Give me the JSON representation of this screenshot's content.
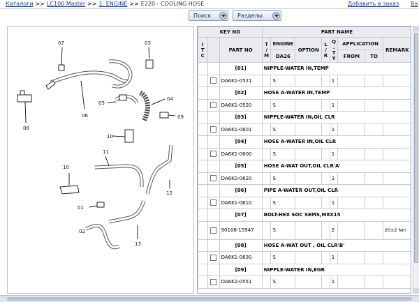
{
  "breadcrumb": {
    "items": [
      "Каталоги",
      "LC100 Master",
      "1. ENGINE",
      "E220 - COOLING HOSE"
    ],
    "separator": ">>",
    "right_links": [
      "Добавить в заказ",
      "Ва"
    ]
  },
  "toolbar": {
    "search_label": "Поиск",
    "sections_label": "Разделы"
  },
  "diagram": {
    "callouts": [
      "07",
      "03",
      "06",
      "04",
      "05",
      "08",
      "09",
      "10",
      "11",
      "10",
      "12",
      "01",
      "02",
      "13"
    ]
  },
  "table": {
    "headers": {
      "key_no": "KEY NO",
      "part_name": "PART NAME",
      "itc": "I T C",
      "part_no": "PART NO",
      "tm": "T / M",
      "engine": "ENGINE",
      "engine_code": "DA26",
      "option": "OPTION",
      "lr": "L / R",
      "qty": "Q . T Y",
      "application": "APPLICATION",
      "from": "FROM",
      "to": "TO",
      "remark": "REMARK"
    },
    "groups": [
      {
        "key": "[01]",
        "name": "NIPPLE-WATER IN,TEMP",
        "part_no": "DA6K1-0521",
        "engine": "S",
        "qty": "1",
        "remark": ""
      },
      {
        "key": "[02]",
        "name": "HOSE A-WATER IN,TEMP",
        "part_no": "DA6K1-0520",
        "engine": "S",
        "qty": "1",
        "remark": ""
      },
      {
        "key": "[03]",
        "name": "NIPPLE-WATER IN,OIL CLR",
        "part_no": "DA6K1-0601",
        "engine": "S",
        "qty": "1",
        "remark": ""
      },
      {
        "key": "[04]",
        "name": "HOSE A-WATER IN,OIL CLR",
        "part_no": "DA6K1-0600",
        "engine": "S",
        "qty": "1",
        "remark": ""
      },
      {
        "key": "[05]",
        "name": "HOSE A-WAT OUT,OIL CLR'A'",
        "part_no": "DA6K0-0620",
        "engine": "S",
        "qty": "1",
        "remark": ""
      },
      {
        "key": "[06]",
        "name": "PIPE A-WATER OUT,OIL CLR",
        "part_no": "DA6K1-0610",
        "engine": "S",
        "qty": "1",
        "remark": ""
      },
      {
        "key": "[07]",
        "name": "BOLT-HEX SOC SEMS,M8X15",
        "part_no": "90108-15947",
        "engine": "S",
        "qty": "2",
        "remark": "20±2 Nm"
      },
      {
        "key": "[08]",
        "name": "HOSE A-WAT OUT , OIL CLR'B'",
        "part_no": "DA6K1-0630",
        "engine": "S",
        "qty": "1",
        "remark": ""
      },
      {
        "key": "[09]",
        "name": "NIPPLE-WATER IN,EGR",
        "part_no": "DA6K2-0551",
        "engine": "S",
        "qty": "1",
        "remark": ""
      }
    ]
  }
}
